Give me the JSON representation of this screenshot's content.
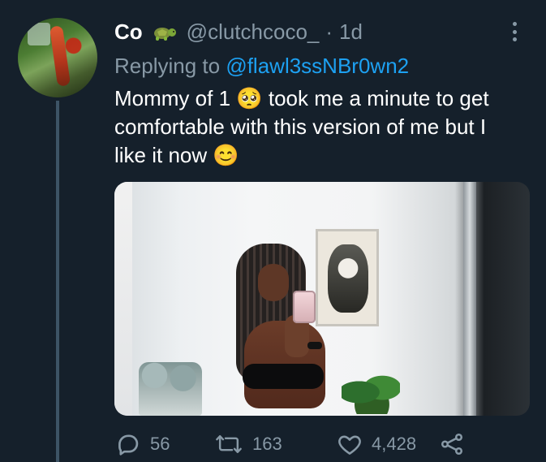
{
  "tweet": {
    "display_name": "Co",
    "display_name_icon": "turtle-icon",
    "handle": "@clutchcoco_",
    "separator": "·",
    "time": "1d",
    "replying_to_label": "Replying to",
    "replying_to_handle": "@flawl3ssNBr0wn2",
    "text_lines": [
      "Mommy of 1 🥺 took me a minute to get",
      "comfortable with this version of me but I",
      "like it now 😊"
    ],
    "counts": {
      "replies": "56",
      "retweets": "163",
      "likes": "4,428"
    }
  },
  "icons": {
    "menu": "more-icon",
    "reply": "reply-icon",
    "retweet": "retweet-icon",
    "like": "heart-icon",
    "share": "share-icon"
  },
  "colors": {
    "background": "#15202b",
    "primary_text": "#ffffff",
    "secondary_text": "#8899a6",
    "accent": "#1da1f2"
  }
}
